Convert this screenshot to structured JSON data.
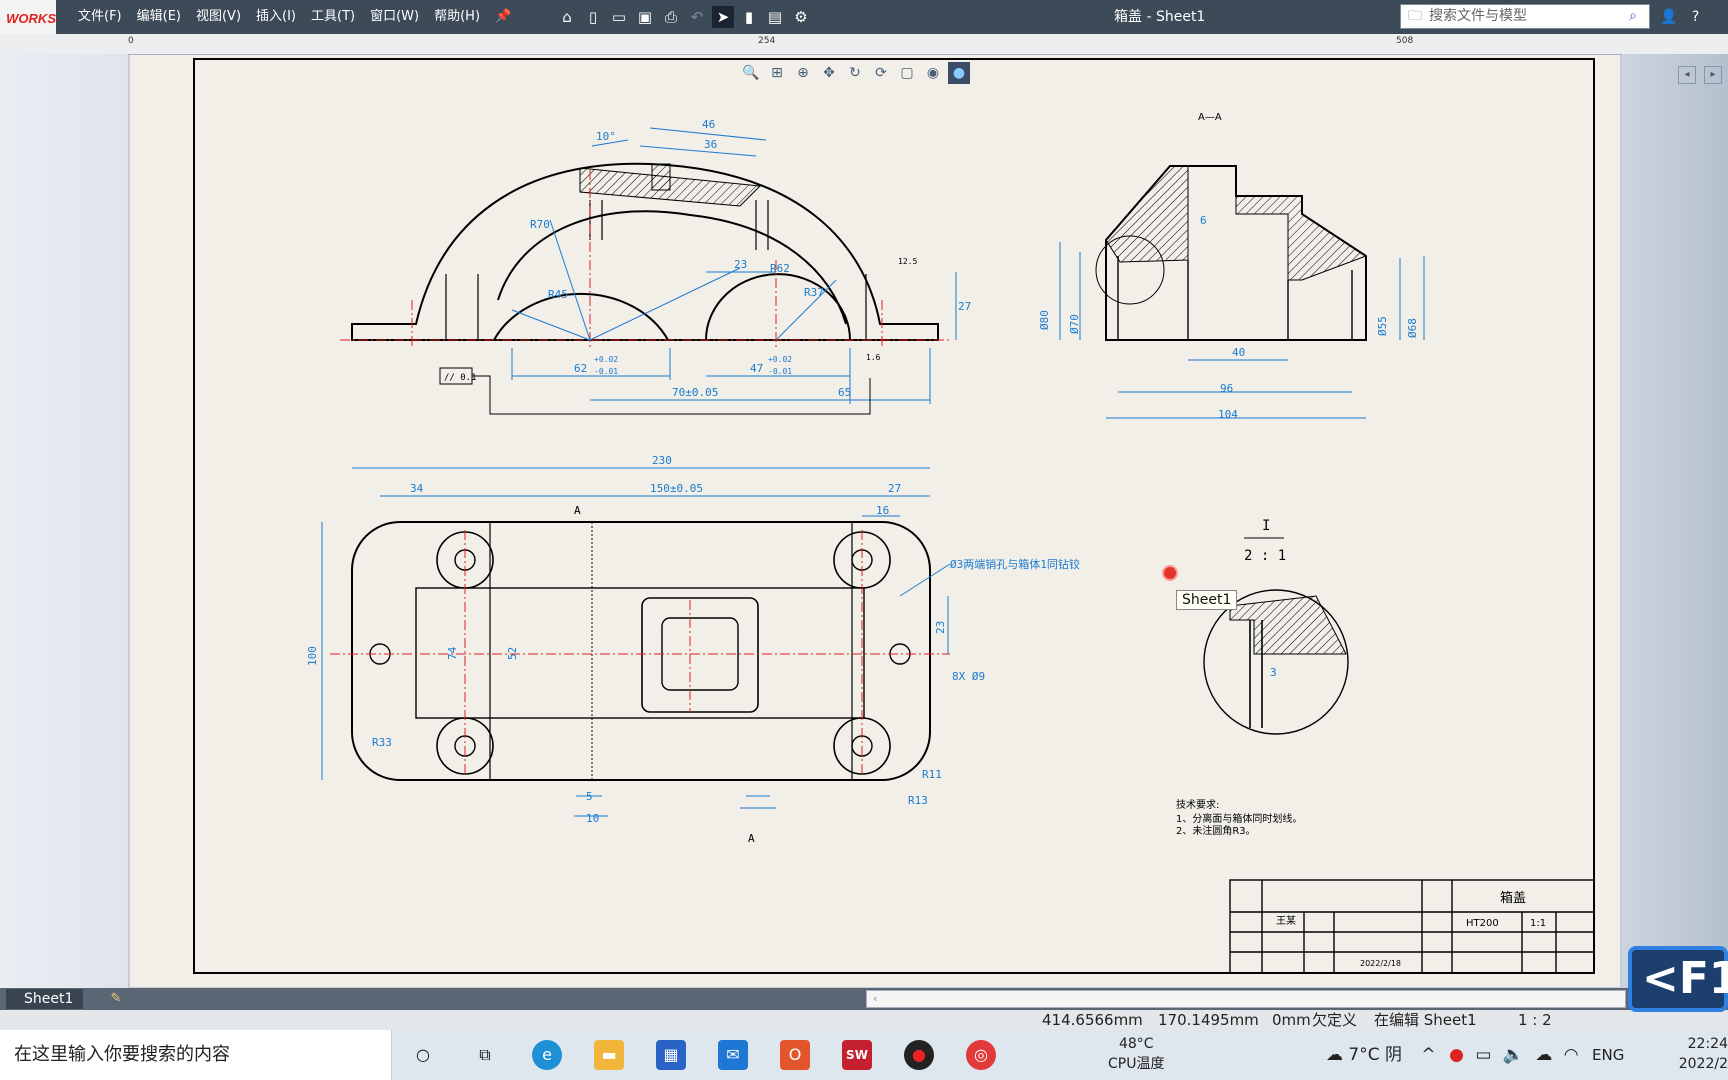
{
  "app": {
    "logo": "WORKS",
    "title": "箱盖 - Sheet1"
  },
  "menu": [
    "文件(F)",
    "编辑(E)",
    "视图(V)",
    "插入(I)",
    "工具(T)",
    "窗口(W)",
    "帮助(H)"
  ],
  "search": {
    "placeholder": "搜索文件与模型"
  },
  "ruler": {
    "labels": [
      "0",
      "254",
      "508"
    ]
  },
  "drawing": {
    "section_label": "A—A",
    "detail_scale_top": "I",
    "detail_scale_bottom": "2 : 1",
    "dims": {
      "d46": "46",
      "d36": "36",
      "d10deg": "10°",
      "r70": "R70",
      "r45": "R45",
      "r62": "R62",
      "r37": "R37",
      "d23": "23",
      "d27": "27",
      "d62": "62",
      "d47": "47",
      "tol_top": "+0.02",
      "tol_bot": "-0.01",
      "d70": "70±0.05",
      "d65": "65",
      "d230": "230",
      "d34": "34",
      "d150": "150±0.05",
      "d27b": "27",
      "d16": "16",
      "d100": "100",
      "d74": "74",
      "d52": "52",
      "d23b": "23",
      "r33": "R33",
      "r11": "R11",
      "r13": "R13",
      "d5": "5",
      "d10": "10",
      "holes": "8X Ø9",
      "pin_note": "Ø3两端销孔与箱体1同钻铰",
      "d40": "40",
      "d96": "96",
      "d104": "104",
      "phi80": "Ø80",
      "phi70": "Ø70",
      "phi55": "Ø55",
      "phi68": "Ø68",
      "d6": "6",
      "d3": "3",
      "sec_a": "A",
      "sec_a2": "A",
      "par": "// 0.1",
      "rough": "12.5",
      "rough2": "1.6"
    },
    "tech_title": "技术要求:",
    "tech_1": "1、分离面与箱体同时划线。",
    "tech_2": "2、未注圆角R3。",
    "titleblock": {
      "part_name": "箱盖",
      "material": "HT200",
      "scale": "1:1",
      "designer": "王某",
      "date": "2022/2/18"
    }
  },
  "tooltip": "Sheet1",
  "tabs": {
    "sheet": "Sheet1"
  },
  "status": {
    "x": "414.6566mm",
    "y": "170.1495mm",
    "z": "0mm",
    "define": "欠定义",
    "editing": "在编辑 Sheet1",
    "scale": "1 : 2"
  },
  "taskbar": {
    "search_placeholder": "在这里输入你要搜索的内容",
    "cpu_temp": "48°C",
    "cpu_label": "CPU温度",
    "weather": "7°C 阴",
    "lang": "ENG",
    "time": "22:24",
    "date": "2022/2"
  },
  "overlay_key": "<F1"
}
